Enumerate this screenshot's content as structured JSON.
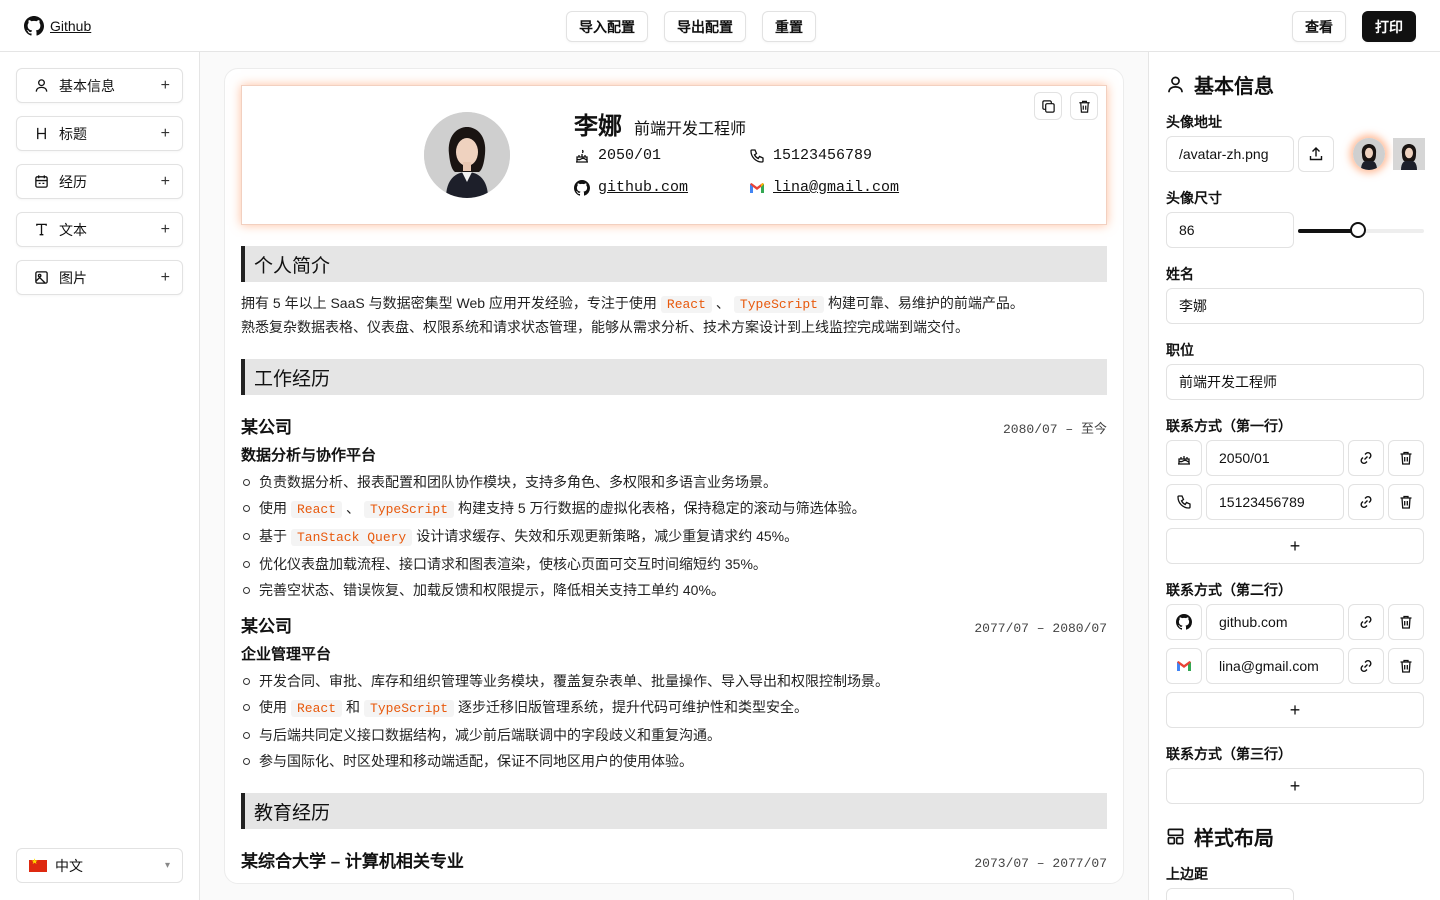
{
  "brand": {
    "label": "Github"
  },
  "toolbar": {
    "import_label": "导入配置",
    "export_label": "导出配置",
    "reset_label": "重置",
    "view_label": "查看",
    "print_label": "打印"
  },
  "sidebar": {
    "items": [
      {
        "label": "基本信息",
        "icon": "user-icon"
      },
      {
        "label": "标题",
        "icon": "heading-icon"
      },
      {
        "label": "经历",
        "icon": "calendar-icon"
      },
      {
        "label": "文本",
        "icon": "text-icon"
      },
      {
        "label": "图片",
        "icon": "image-icon"
      }
    ],
    "language": "中文"
  },
  "resume": {
    "name": "李娜",
    "title": "前端开发工程师",
    "birth": "2050/01",
    "phone": "15123456789",
    "github": "github.com",
    "email": "lina@gmail.com",
    "sections": {
      "intro": "个人简介",
      "work": "工作经历",
      "edu": "教育经历"
    },
    "intro": {
      "p1_a": "拥有 5 年以上 SaaS 与数据密集型 Web 应用开发经验，专注于使用",
      "tag1": "React",
      "sep": "、",
      "tag2": "TypeScript",
      "p1_b": "构建可靠、易维护的前端产品。",
      "p2": "熟悉复杂数据表格、仪表盘、权限系统和请求状态管理，能够从需求分析、技术方案设计到上线监控完成端到端交付。"
    },
    "jobs": [
      {
        "company": "某公司",
        "date": "2080/07 – 至今",
        "project": "数据分析与协作平台",
        "b1": "负责数据分析、报表配置和团队协作模块，支持多角色、多权限和多语言业务场景。",
        "b2_a": "使用",
        "b2_t1": "React",
        "b2_s": "、",
        "b2_t2": "TypeScript",
        "b2_b": "构建支持 5 万行数据的虚拟化表格，保持稳定的滚动与筛选体验。",
        "b3_a": "基于",
        "b3_t1": "TanStack Query",
        "b3_b": "设计请求缓存、失效和乐观更新策略，减少重复请求约 45%。",
        "b4": "优化仪表盘加载流程、接口请求和图表渲染，使核心页面可交互时间缩短约 35%。",
        "b5": "完善空状态、错误恢复、加载反馈和权限提示，降低相关支持工单约 40%。"
      },
      {
        "company": "某公司",
        "date": "2077/07 – 2080/07",
        "project": "企业管理平台",
        "b1": "开发合同、审批、库存和组织管理等业务模块，覆盖复杂表单、批量操作、导入导出和权限控制场景。",
        "b2_a": "使用",
        "b2_t1": "React",
        "b2_s": "和",
        "b2_t2": "TypeScript",
        "b2_b": "逐步迁移旧版管理系统，提升代码可维护性和类型安全。",
        "b3": "与后端共同定义接口数据结构，减少前后端联调中的字段歧义和重复沟通。",
        "b4": "参与国际化、时区处理和移动端适配，保证不同地区用户的使用体验。"
      }
    ],
    "edu": {
      "school": "某综合大学 – 计算机相关专业",
      "date": "2073/07 – 2077/07"
    }
  },
  "panel": {
    "basic_title": "基本信息",
    "avatar_label": "头像地址",
    "avatar_value": "/avatar-zh.png",
    "size_label": "头像尺寸",
    "size_value": "86",
    "size_slider_fraction": 0.48,
    "name_label": "姓名",
    "name_value": "李娜",
    "title_label": "职位",
    "title_value": "前端开发工程师",
    "contact1_label": "联系方式（第一行）",
    "contact1": [
      "2050/01",
      "15123456789"
    ],
    "contact2_label": "联系方式（第二行）",
    "contact2": [
      "github.com",
      "lina@gmail.com"
    ],
    "contact3_label": "联系方式（第三行）",
    "add_label": "+",
    "style_title": "样式布局",
    "margin_top_label": "上边距"
  },
  "colors": {
    "accent": "#e8590c",
    "glow": "#ff8c50",
    "dark": "#111111"
  }
}
